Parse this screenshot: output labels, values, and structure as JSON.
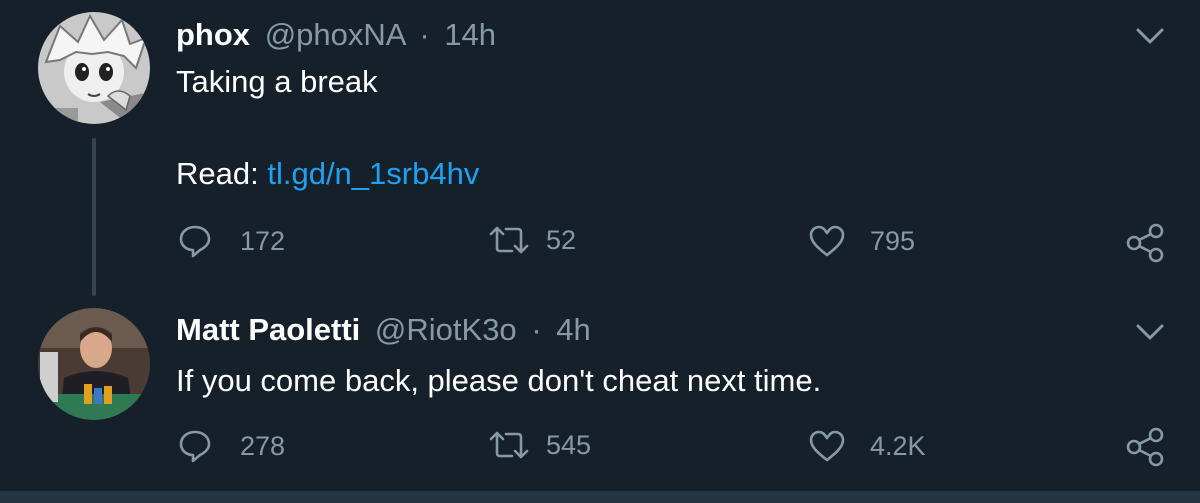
{
  "tweets": [
    {
      "name": "phox",
      "handle": "@phoxNA",
      "separator": "·",
      "time": "14h",
      "text_line1": "Taking a break",
      "text_line2_prefix": "Read: ",
      "link": "tl.gd/n_1srb4hv",
      "replies": "172",
      "retweets": "52",
      "likes": "795"
    },
    {
      "name": "Matt Paoletti",
      "handle": "@RiotK3o",
      "separator": "·",
      "time": "4h",
      "text_line1": "If you come back, please don't cheat next time.",
      "replies": "278",
      "retweets": "545",
      "likes": "4.2K"
    }
  ],
  "colors": {
    "background": "#15202b",
    "secondary_text": "#8899a6",
    "link": "#1da1f2",
    "thread_line": "#38444d"
  },
  "icons": [
    "chevron-down-icon",
    "reply-icon",
    "retweet-icon",
    "like-icon",
    "share-icon"
  ]
}
